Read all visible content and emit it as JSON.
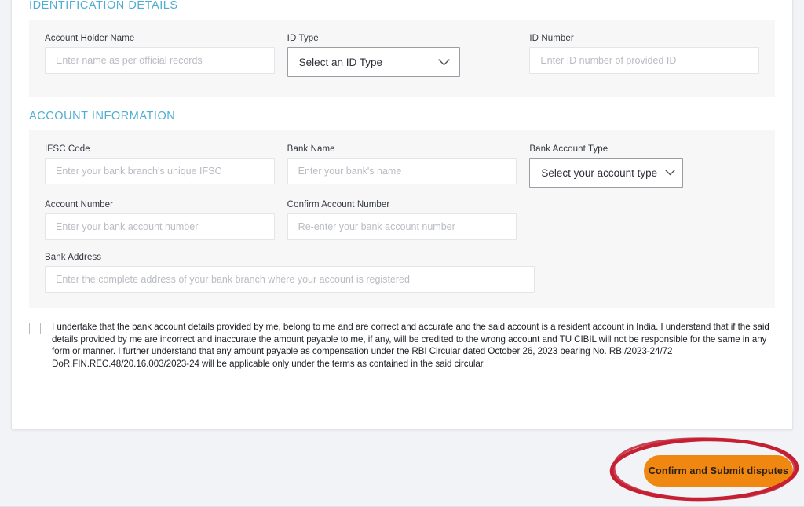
{
  "sections": [
    {
      "id": "identification",
      "title": "IDENTIFICATION DETAILS"
    },
    {
      "id": "account",
      "title": "ACCOUNT INFORMATION"
    }
  ],
  "identification": {
    "title": "IDENTIFICATION DETAILS",
    "fields": {
      "account_holder_name": {
        "label": "Account Holder Name",
        "placeholder": "Enter name as per official records",
        "value": ""
      },
      "id_type": {
        "label": "ID Type",
        "selected": "Select an ID Type",
        "icon": "chevron-down-icon"
      },
      "id_number": {
        "label": "ID Number",
        "placeholder": "Enter ID number of provided ID",
        "value": ""
      }
    }
  },
  "account_information": {
    "title": "ACCOUNT INFORMATION",
    "fields": {
      "ifsc_code": {
        "label": "IFSC Code",
        "placeholder": "Enter your bank branch's unique IFSC",
        "value": ""
      },
      "bank_name": {
        "label": "Bank Name",
        "placeholder": "Enter your bank's name",
        "value": ""
      },
      "bank_account_type": {
        "label": "Bank Account Type",
        "selected": "Select your account type",
        "icon": "chevron-down-icon"
      },
      "account_number": {
        "label": "Account Number",
        "placeholder": "Enter your bank account number",
        "value": ""
      },
      "confirm_account_number": {
        "label": "Confirm Account Number",
        "placeholder": "Re-enter your bank account number",
        "value": ""
      },
      "bank_address": {
        "label": "Bank Address",
        "placeholder": "Enter the complete address of your bank branch where your account is registered",
        "value": ""
      }
    }
  },
  "undertaking": {
    "checked": false,
    "text": "I undertake that the bank account details provided by me, belong to me and are correct and accurate and the said account is a resident account in India. I understand that if the said details provided by me are incorrect and inaccurate the amount payable to me, if any, will be credited to the wrong account and TU CIBIL will not be responsible for the same in any form or manner. I further understand that any amount payable as compensation under the RBI Circular dated October 26, 2023 bearing No. RBI/2023-24/72 DoR.FIN.REC.48/20.16.003/2023-24 will be applicable only under the terms as contained in the said circular."
  },
  "submit": {
    "label": "Confirm and Submit disputes"
  },
  "annotation": {
    "shape": "ellipse-highlight",
    "color": "#c42032"
  },
  "colors": {
    "section_heading": "#4eaed2",
    "submit_button": "#ef8711",
    "annotation_red": "#c42032",
    "panel_background": "#f7f7f8",
    "page_background": "#f2f3f6",
    "card_background": "#ffffff"
  }
}
